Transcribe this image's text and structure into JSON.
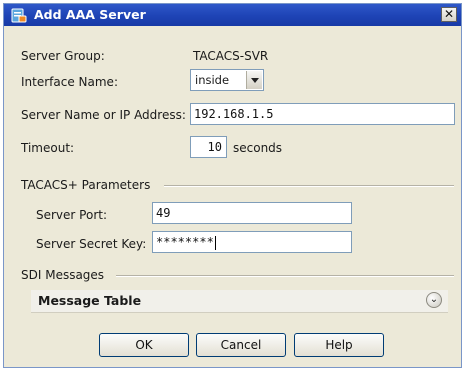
{
  "window": {
    "title": "Add AAA Server",
    "close_glyph": "✕"
  },
  "form": {
    "server_group_label": "Server Group:",
    "server_group_value": "TACACS-SVR",
    "interface_label": "Interface Name:",
    "interface_value": "inside",
    "server_name_label": "Server Name or IP Address:",
    "server_name_value": "192.168.1.5",
    "timeout_label": "Timeout:",
    "timeout_value": "10",
    "timeout_unit": "seconds"
  },
  "tacacs": {
    "section_label": "TACACS+ Parameters",
    "server_port_label": "Server Port:",
    "server_port_value": "49",
    "secret_key_label": "Server Secret Key:",
    "secret_key_value": "********"
  },
  "sdi": {
    "section_label": "SDI Messages",
    "table_title": "Message Table",
    "expand_glyph": "⌄"
  },
  "buttons": {
    "ok": "OK",
    "cancel": "Cancel",
    "help": "Help"
  },
  "icons": {
    "app": "aaa-server-icon",
    "close": "close-icon",
    "dropdown": "chevron-down-icon",
    "expand": "expand-icon"
  },
  "colors": {
    "titlebar": "#1f45b7",
    "dialog_bg": "#ece9d8",
    "field_border": "#7f9db9"
  }
}
